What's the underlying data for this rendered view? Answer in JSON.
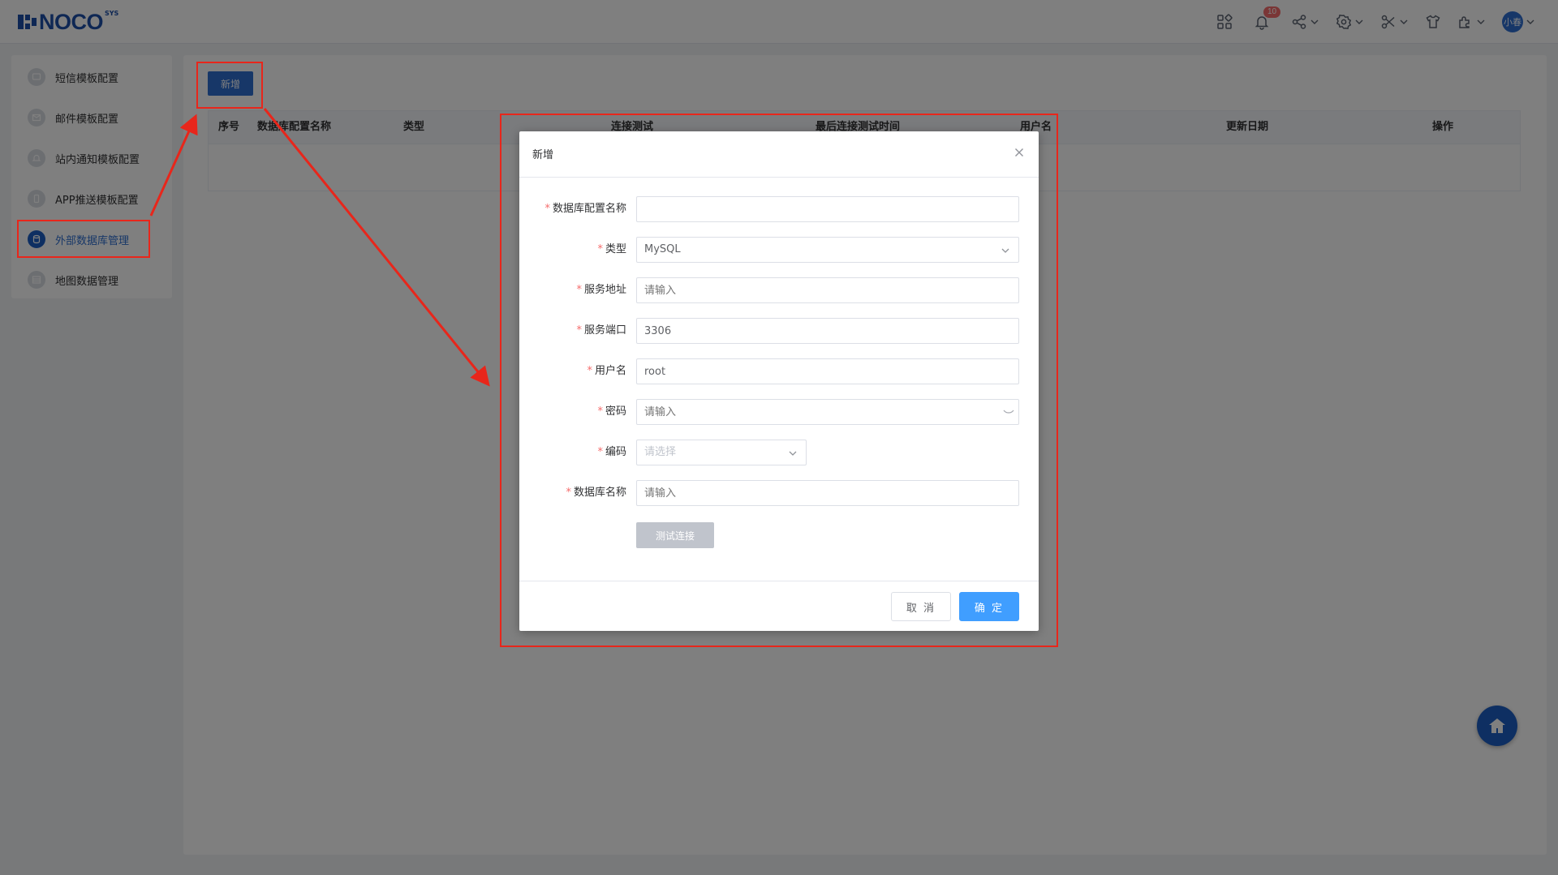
{
  "header": {
    "logo_text": "NOCO",
    "logo_sup": "SYS",
    "notification_count": "10",
    "avatar_label": "小春",
    "icons": [
      "apps-icon",
      "bell-icon",
      "share-icon",
      "gear-icon",
      "tools-icon",
      "shirt-icon",
      "puzzle-icon"
    ]
  },
  "sidebar": {
    "items": [
      {
        "label": "短信模板配置",
        "icon": "message-icon"
      },
      {
        "label": "邮件模板配置",
        "icon": "mail-icon"
      },
      {
        "label": "站内通知模板配置",
        "icon": "bell-icon"
      },
      {
        "label": "APP推送模板配置",
        "icon": "phone-icon"
      },
      {
        "label": "外部数据库管理",
        "icon": "database-icon",
        "active": true
      },
      {
        "label": "地图数据管理",
        "icon": "map-icon"
      }
    ]
  },
  "main": {
    "add_button": "新增",
    "table_headers": [
      "序号",
      "数据库配置名称",
      "类型",
      "连接测试",
      "最后连接测试时间",
      "用户名",
      "更新日期",
      "操作"
    ]
  },
  "dialog": {
    "title": "新增",
    "fields": {
      "config_name": {
        "label": "数据库配置名称",
        "value": "",
        "placeholder": ""
      },
      "type": {
        "label": "类型",
        "value": "MySQL"
      },
      "host": {
        "label": "服务地址",
        "value": "",
        "placeholder": "请输入"
      },
      "port": {
        "label": "服务端口",
        "value": "3306"
      },
      "username": {
        "label": "用户名",
        "value": "root"
      },
      "password": {
        "label": "密码",
        "value": "",
        "placeholder": "请输入"
      },
      "encoding": {
        "label": "编码",
        "value": "",
        "placeholder": "请选择"
      },
      "db_name": {
        "label": "数据库名称",
        "value": "",
        "placeholder": "请输入"
      }
    },
    "test_button": "测试连接",
    "cancel_button": "取 消",
    "ok_button": "确 定"
  },
  "colors": {
    "primary": "#2f6fd1",
    "confirm": "#409eff",
    "annotation": "#e8261b",
    "required": "#f56c6c"
  }
}
